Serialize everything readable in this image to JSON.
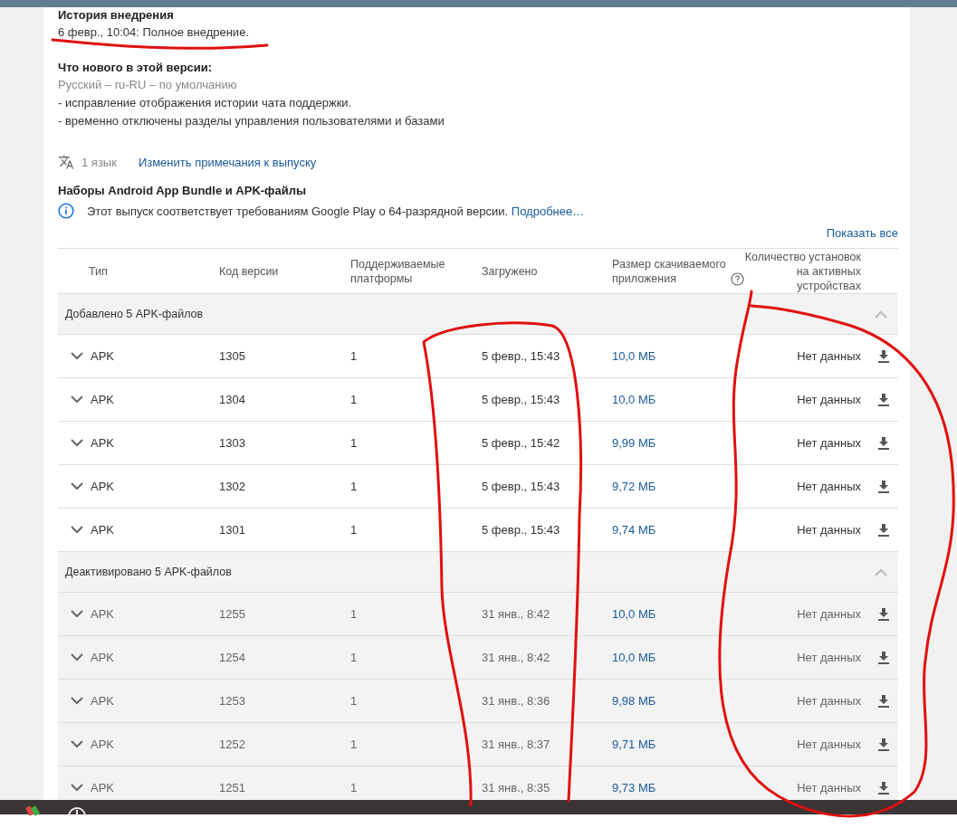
{
  "history": {
    "title": "История внедрения",
    "entry": "6 февр., 10:04: Полное внедрение."
  },
  "whats_new": {
    "title": "Что нового в этой версии:",
    "language": "Русский – ru-RU – по умолчанию",
    "lines": [
      "- исправление отображения истории чата поддержки.",
      "- временно отключены разделы управления пользователями и базами"
    ]
  },
  "languages": {
    "count": "1 язык",
    "edit_link": "Изменить примечания к выпуску"
  },
  "bundles": {
    "title": "Наборы Android App Bundle и APK-файлы",
    "notice": "Этот выпуск соответствует требованиям Google Play о 64-разрядной версии.",
    "notice_link": "Подробнее…",
    "show_all": "Показать все"
  },
  "table": {
    "columns": [
      "Тип",
      "Код версии",
      "Поддерживаемые платформы",
      "Загружено",
      "Размер скачиваемого приложения",
      "Количество установок на активных устройствах"
    ],
    "groups": [
      {
        "title": "Добавлено 5 APK-файлов",
        "expanded": true,
        "disabled": false,
        "rows": [
          {
            "type": "APK",
            "code": "1305",
            "platforms": "1",
            "uploaded": "5 февр., 15:43",
            "size": "10,0 МБ",
            "installs": "Нет данных"
          },
          {
            "type": "APK",
            "code": "1304",
            "platforms": "1",
            "uploaded": "5 февр., 15:43",
            "size": "10,0 МБ",
            "installs": "Нет данных"
          },
          {
            "type": "APK",
            "code": "1303",
            "platforms": "1",
            "uploaded": "5 февр., 15:42",
            "size": "9,99 МБ",
            "installs": "Нет данных"
          },
          {
            "type": "APK",
            "code": "1302",
            "platforms": "1",
            "uploaded": "5 февр., 15:43",
            "size": "9,72 МБ",
            "installs": "Нет данных"
          },
          {
            "type": "APK",
            "code": "1301",
            "platforms": "1",
            "uploaded": "5 февр., 15:43",
            "size": "9,74 МБ",
            "installs": "Нет данных"
          }
        ]
      },
      {
        "title": "Деактивировано 5 APK-файлов",
        "expanded": true,
        "disabled": true,
        "rows": [
          {
            "type": "APK",
            "code": "1255",
            "platforms": "1",
            "uploaded": "31 янв., 8:42",
            "size": "10,0 МБ",
            "installs": "Нет данных"
          },
          {
            "type": "APK",
            "code": "1254",
            "platforms": "1",
            "uploaded": "31 янв., 8:42",
            "size": "10,0 МБ",
            "installs": "Нет данных"
          },
          {
            "type": "APK",
            "code": "1253",
            "platforms": "1",
            "uploaded": "31 янв., 8:36",
            "size": "9,98 МБ",
            "installs": "Нет данных"
          },
          {
            "type": "APK",
            "code": "1252",
            "platforms": "1",
            "uploaded": "31 янв., 8:37",
            "size": "9,71 МБ",
            "installs": "Нет данных"
          },
          {
            "type": "APK",
            "code": "1251",
            "platforms": "1",
            "uploaded": "31 янв., 8:35",
            "size": "9,73 МБ",
            "installs": "Нет данных"
          }
        ]
      }
    ]
  }
}
